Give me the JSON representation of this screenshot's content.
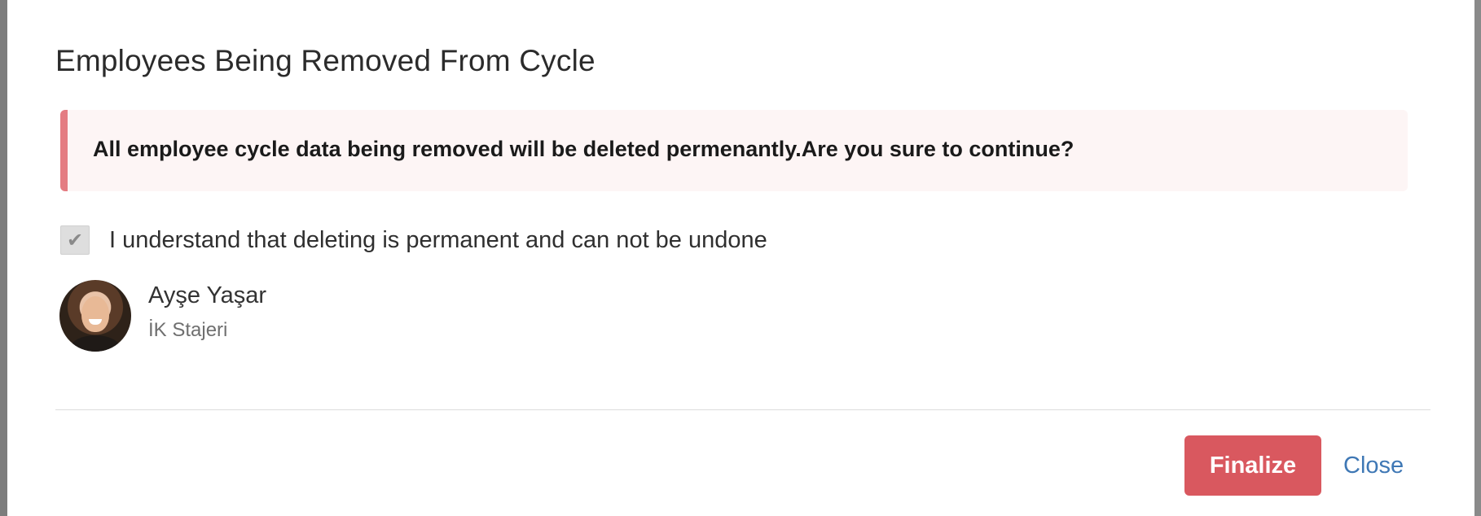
{
  "dialog": {
    "title": "Employees Being Removed From Cycle",
    "alert_message": "All employee cycle data being removed will be deleted permenantly.Are you sure to continue?",
    "confirm_checkbox": {
      "checked": true,
      "label": "I understand that deleting is permanent and can not be undone"
    },
    "employees": [
      {
        "name": "Ayşe Yaşar",
        "role": "İK Stajeri",
        "avatar_icon": "user-photo"
      }
    ],
    "buttons": {
      "finalize_label": "Finalize",
      "close_label": "Close"
    }
  },
  "colors": {
    "alert_border": "#e47c82",
    "alert_background": "#fdf5f5",
    "finalize_button": "#d9585f",
    "close_link": "#3f78b5"
  },
  "icons": {
    "checkbox_check": "checkmark-icon"
  }
}
